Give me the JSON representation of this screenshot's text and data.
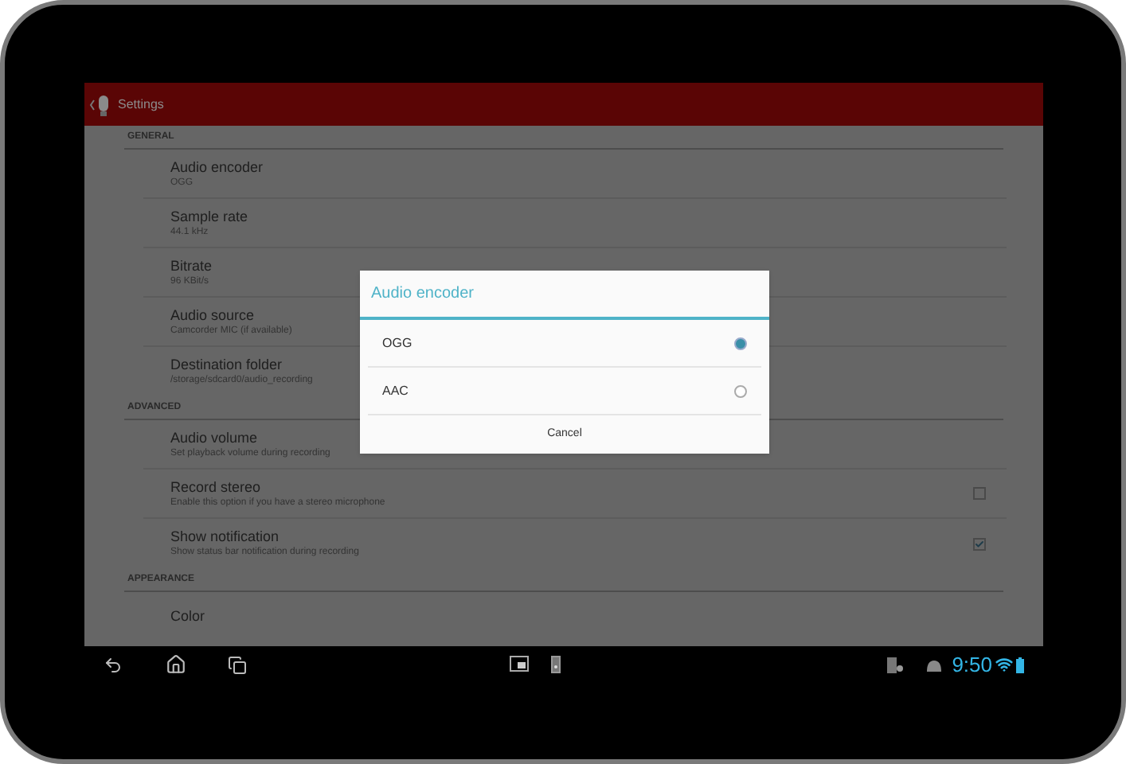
{
  "action_bar": {
    "title": "Settings"
  },
  "sections": [
    {
      "title": "GENERAL",
      "items": [
        {
          "kind": "plain",
          "title": "Audio encoder",
          "summary": "OGG"
        },
        {
          "kind": "plain",
          "title": "Sample rate",
          "summary": "44.1 kHz"
        },
        {
          "kind": "plain",
          "title": "Bitrate",
          "summary": "96 KBit/s"
        },
        {
          "kind": "plain",
          "title": "Audio source",
          "summary": "Camcorder MIC (if available)"
        },
        {
          "kind": "plain",
          "title": "Destination folder",
          "summary": "/storage/sdcard0/audio_recording"
        }
      ]
    },
    {
      "title": "ADVANCED",
      "items": [
        {
          "kind": "plain",
          "title": "Audio volume",
          "summary": "Set playback volume during recording"
        },
        {
          "kind": "checkbox",
          "title": "Record stereo",
          "summary": "Enable this option if you have a stereo microphone",
          "checked": false
        },
        {
          "kind": "checkbox",
          "title": "Show notification",
          "summary": "Show status bar notification during recording",
          "checked": true
        }
      ]
    },
    {
      "title": "APPEARANCE",
      "items": [
        {
          "kind": "plain",
          "title": "Color"
        }
      ]
    }
  ],
  "dialog": {
    "title": "Audio encoder",
    "options": [
      {
        "label": "OGG",
        "selected": true
      },
      {
        "label": "AAC",
        "selected": false
      }
    ],
    "cancel": "Cancel"
  },
  "status_bar": {
    "time": "9:50"
  }
}
